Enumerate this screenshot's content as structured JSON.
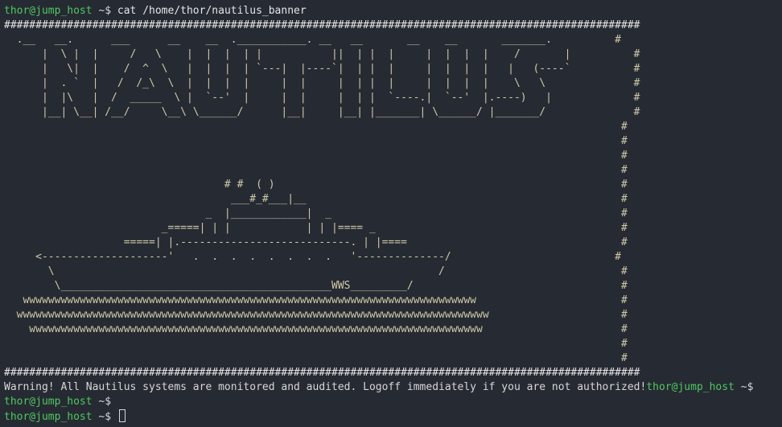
{
  "terminal": {
    "prompt_user_host": "thor@jump_host",
    "prompt_dir": "~",
    "prompt_symbol": "$",
    "command": "cat /home/thor/nautilus_banner",
    "banner_lines": [
      "#####################################################################################################",
      "  .__   __.      ___      __    __  .___________. __   __       __    __       _______.          #",
      "      |  \\ |  |     /   \\    |  |  |  | |           ||  | |  |     |  |  |  |    /       |          #",
      "      |   \\|  |    /  ^  \\   |  |  |  | `---|  |----`|  | |  |     |  |  |  |   |   (----`          #",
      "      |  . `  |   /  /_\\  \\  |  |  |  |     |  |     |  | |  |     |  |  |  |    \\   \\              #",
      "      |  |\\   |  /  _____  \\ |  `--'  |     |  |     |  | |  `----.|  `--'  |.----)   |             #",
      "      |__| \\__| /__/     \\__\\ \\______/      |__|     |__| |_______| \\______/ |_______/              #",
      "                                                                                                  #",
      "                                                                                                  #",
      "                                                                                                  #",
      "                                                                                                  #",
      "                                   # #  ( )                                                       #",
      "                                    ___#_#___|__                                                  #",
      "                                _  |____________|  _                                              #",
      "                         _=====| | |            | | |==== _                                       #",
      "                   =====| |.---------------------------. | |====                                  #",
      "     <--------------------'   .  .  .  .  .  .  .  .   '--------------/                          #",
      "       \\                                                             /                            #",
      "        \\___________________________________________WWS_________/                                 #",
      "   wwwwwwwwwwwwwwwwwwwwwwwwwwwwwwwwwwwwwwwwwwwwwwwwwwwwwwwwwwwwwwwwwwwwwwww                       #",
      "  wwwwwwwwwwwwwwwwwwwwwwwwwwwwwwwwwwwwwwwwwwwwwwwwwwwwwwwwwwwwwwwwwwwwwwwwwww                     #",
      "    wwwwwwwwwwwwwwwwwwwwwwwwwwwwwwwwwwwwwwwwwwwwwwwwwwwwwwwwwwwwwwwwwwwwwwww                      #",
      "                                                                                                  #",
      "                                                                                                  #",
      "#####################################################################################################"
    ],
    "warning": "Warning! All Nautilus systems are monitored and audited. Logoff immediately if you are not authorized!",
    "colors": {
      "background": "#262a33",
      "prompt_host": "#4fc85f",
      "text": "#d7d7d7",
      "banner": "#cfc9a8"
    }
  }
}
